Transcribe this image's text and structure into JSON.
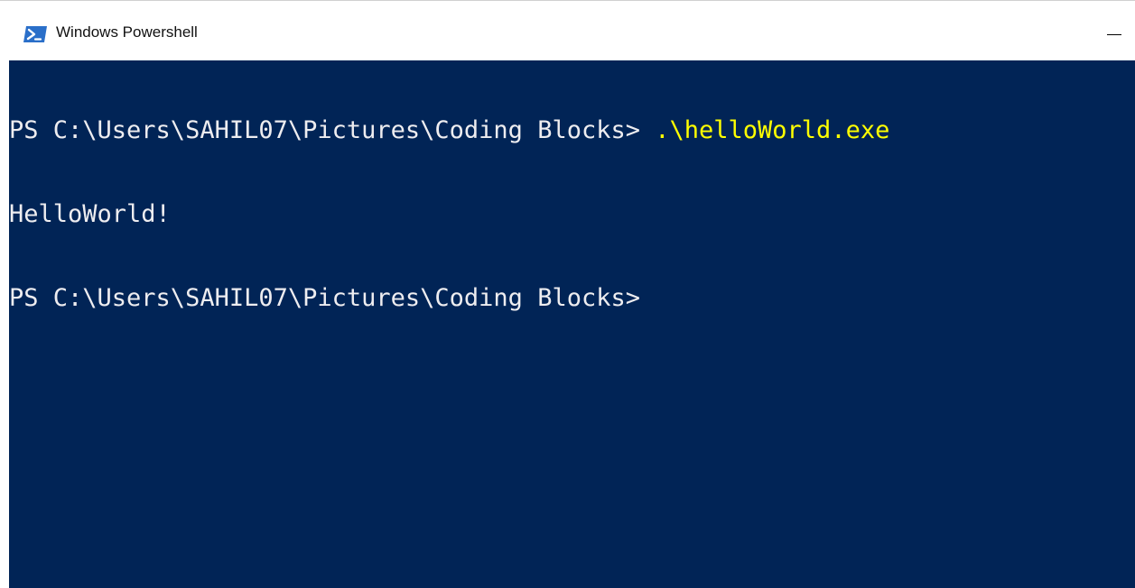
{
  "window": {
    "title": "Windows Powershell",
    "icon": "powershell-icon",
    "minimize_icon": "minimize-icon"
  },
  "colors": {
    "console_background": "#012456",
    "console_foreground": "#eeedf0",
    "command_highlight": "#ffff00",
    "icon_blue": "#2a6fc9"
  },
  "console": {
    "lines": [
      {
        "prompt": "PS C:\\Users\\SAHIL07\\Pictures\\Coding Blocks> ",
        "command": ".\\helloWorld.exe"
      },
      {
        "output": "HelloWorld!"
      },
      {
        "prompt": "PS C:\\Users\\SAHIL07\\Pictures\\Coding Blocks>",
        "command": ""
      }
    ]
  }
}
